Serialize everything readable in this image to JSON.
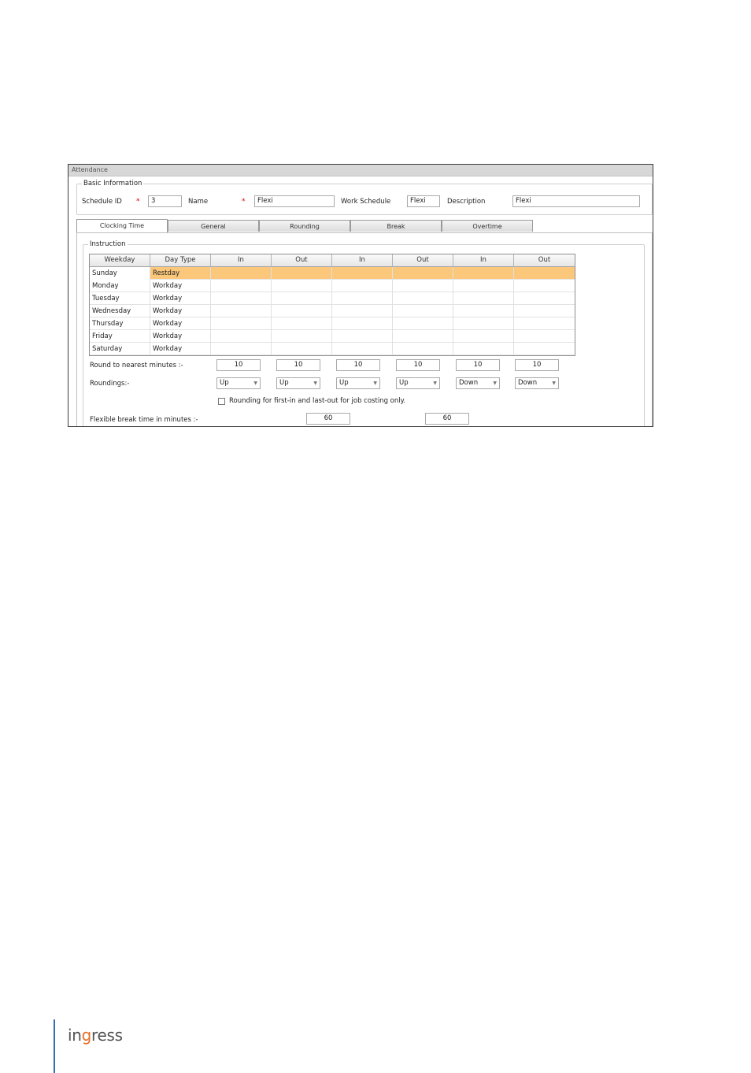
{
  "window": {
    "title": "Attendance"
  },
  "basic_info": {
    "legend": "Basic Information",
    "schedule_id_label": "Schedule ID",
    "schedule_id_value": "3",
    "name_label": "Name",
    "name_value": "Flexi",
    "work_schedule_label": "Work Schedule",
    "work_schedule_value": "Flexi",
    "description_label": "Description",
    "description_value": "Flexi",
    "required_mark": "*"
  },
  "tabs": [
    {
      "label": "Clocking Time",
      "active": true
    },
    {
      "label": "General",
      "active": false
    },
    {
      "label": "Rounding",
      "active": false
    },
    {
      "label": "Break",
      "active": false
    },
    {
      "label": "Overtime",
      "active": false
    }
  ],
  "instruction": {
    "legend": "Instruction",
    "columns": [
      "Weekday",
      "Day Type",
      "In",
      "Out",
      "In",
      "Out",
      "In",
      "Out"
    ],
    "rows": [
      {
        "weekday": "Sunday",
        "day_type": "Restday",
        "selected": true
      },
      {
        "weekday": "Monday",
        "day_type": "Workday",
        "selected": false
      },
      {
        "weekday": "Tuesday",
        "day_type": "Workday",
        "selected": false
      },
      {
        "weekday": "Wednesday",
        "day_type": "Workday",
        "selected": false
      },
      {
        "weekday": "Thursday",
        "day_type": "Workday",
        "selected": false
      },
      {
        "weekday": "Friday",
        "day_type": "Workday",
        "selected": false
      },
      {
        "weekday": "Saturday",
        "day_type": "Workday",
        "selected": false
      }
    ],
    "round_label": "Round to nearest minutes :-",
    "round_values": [
      "10",
      "10",
      "10",
      "10",
      "10",
      "10"
    ],
    "roundings_label": "Roundings:-",
    "roundings_values": [
      "Up",
      "Up",
      "Up",
      "Up",
      "Down",
      "Down"
    ],
    "checkbox_label": "Rounding for first-in and last-out for job costing only.",
    "flex_break_label": "Flexible break time in minutes :-",
    "flex_break_values": [
      "60",
      "60"
    ]
  },
  "footer": {
    "logo_text_pre": "in",
    "logo_text_dot": "g",
    "logo_text_post": "ress"
  },
  "colors": {
    "selected_row": "#fbc77b",
    "accent_line": "#2d6fb5",
    "logo_accent": "#e8702a"
  }
}
